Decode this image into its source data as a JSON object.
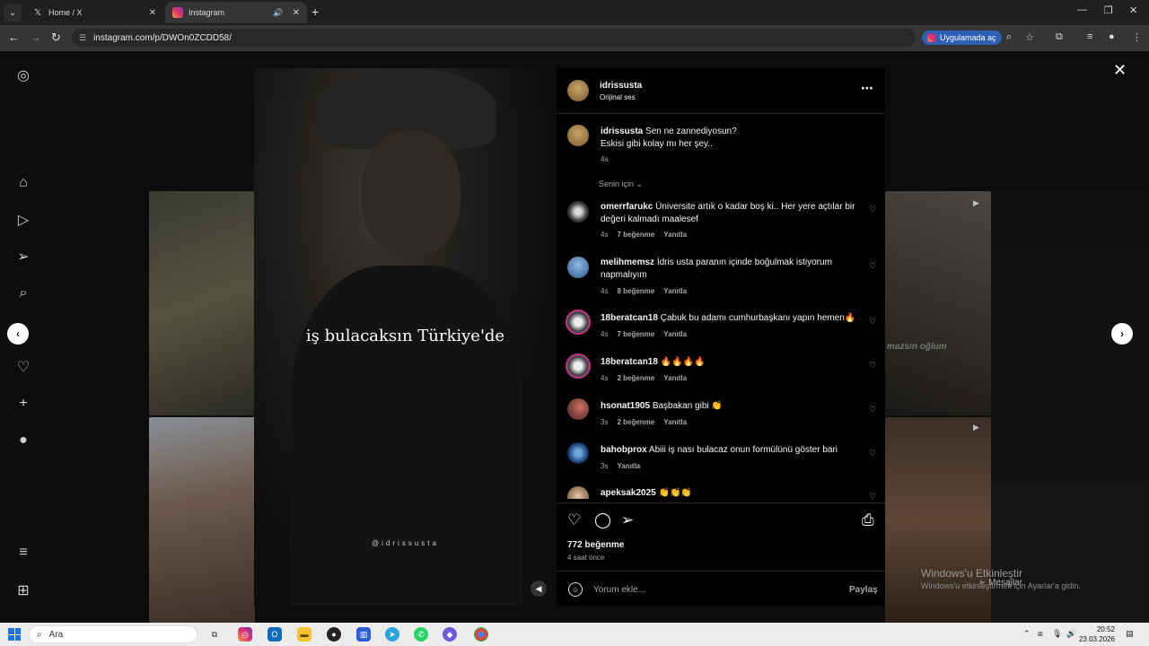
{
  "browser": {
    "tabs": [
      {
        "title": "Home / X",
        "icon": "x-logo-icon",
        "active": false
      },
      {
        "title": "Instagram",
        "icon": "instagram-icon",
        "active": true
      }
    ],
    "url": "instagram.com/p/DWOn0ZCDD58/",
    "open_in_app_label": "Uygulamada aç"
  },
  "media": {
    "caption_overlay": "iş bulacaksın Türkiye'de",
    "watermark": "@idrissusta"
  },
  "post": {
    "author": "idrissusta",
    "audio": "Orijinal ses",
    "caption_user": "idrissusta",
    "caption_line1": "Sen ne zannediyosun?",
    "caption_line2": "Eskisi gibi kolay mı her şey..",
    "caption_time": "4s",
    "sort_label": "Senin için",
    "likes": "772 beğenme",
    "posted_ago": "4 saat önce",
    "comment_placeholder": "Yorum ekle...",
    "share_label": "Paylaş"
  },
  "comments": [
    {
      "user": "omerrfarukc",
      "text": "Üniversite artık o kadar boş ki.. Her yere açtılar bir değeri kalmadı maalesef",
      "time": "4s",
      "likes": "7 beğenme",
      "reply": "Yanıtla"
    },
    {
      "user": "melihmemsz",
      "text": "İdris usta paranın içinde boğulmak istiyorum napmalıyım",
      "time": "4s",
      "likes": "8 beğenme",
      "reply": "Yanıtla"
    },
    {
      "user": "18beratcan18",
      "text": "Çabuk bu adamı cumhurbaşkanı yapın hemen🔥",
      "time": "4s",
      "likes": "7 beğenme",
      "reply": "Yanıtla"
    },
    {
      "user": "18beratcan18",
      "text": "🔥🔥🔥🔥",
      "time": "4s",
      "likes": "2 beğenme",
      "reply": "Yanıtla"
    },
    {
      "user": "hsonat1905",
      "text": "Başbakan gibi 👏",
      "time": "3s",
      "likes": "2 beğenme",
      "reply": "Yanıtla"
    },
    {
      "user": "bahobprox",
      "text": "Abiii iş nası bulacaz onun formülünü göster bari",
      "time": "3s",
      "likes": "",
      "reply": "Yanıtla"
    },
    {
      "user": "apeksak2025",
      "text": "👏👏👏",
      "time": "",
      "likes": "",
      "reply": ""
    }
  ],
  "background": {
    "right_tile_text": "mazsın oğlum",
    "messages_label": "Mesajlar"
  },
  "windows": {
    "activate_title": "Windows'u Etkinleştir",
    "activate_sub": "Windows'u etkinleştirmek için Ayarlar'a gidin.",
    "search_label": "Ara",
    "time": "20:52",
    "date": "23.03.2026"
  }
}
